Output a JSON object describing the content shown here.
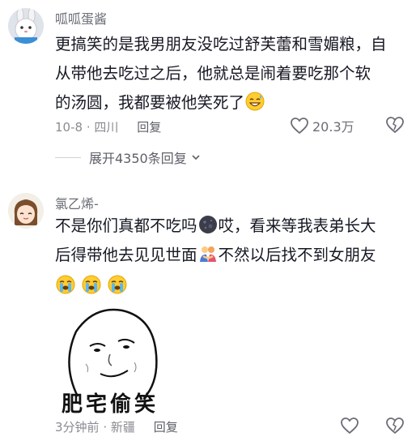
{
  "comments": [
    {
      "username": "呱呱蛋酱",
      "text_lines": [
        "更搞笑的是我男朋友没吃过舒芙蕾和雪媚粮，自",
        "从带他去吃过之后，他就总是闹着要吃那个软",
        "的汤圆，我都要被他笑死了"
      ],
      "trailing_emoji": "grinning-sweat-emoji",
      "date": "10-8",
      "location": "四川",
      "reply_label": "回复",
      "like_count": "20.3万",
      "expand_replies_label": "展开4350条回复"
    },
    {
      "username": "氯乙烯-",
      "text_lines": [
        "不是你们真都不吃吗",
        "哎，看来等我表弟长大",
        "后得带他去见见世面",
        "不然以后找不到女朋友"
      ],
      "inline_emojis": [
        "dark-moon-face-emoji",
        "hugging-people-emoji",
        "loudly-crying-emoji"
      ],
      "sticker_caption": "肥宅偷笑",
      "time": "3分钟前",
      "location": "新疆",
      "reply_label": "回复"
    }
  ],
  "colors": {
    "text": "#161823",
    "meta": "#8a8b91",
    "username": "#6b6d76"
  }
}
